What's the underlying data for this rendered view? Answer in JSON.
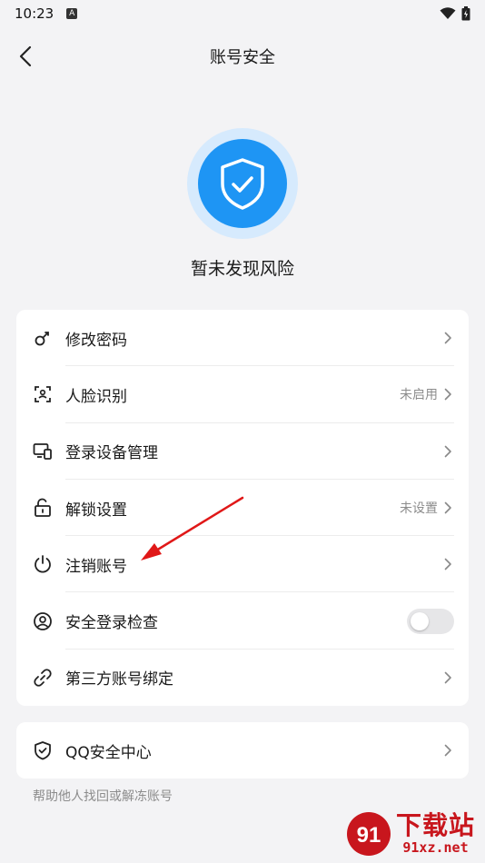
{
  "status_bar": {
    "time": "10:23",
    "notif_icon": "A"
  },
  "header": {
    "title": "账号安全"
  },
  "hero": {
    "icon": "shield-check-icon",
    "status": "暂未发现风险",
    "accent": "#1e95f4"
  },
  "items": [
    {
      "label": "修改密码",
      "value": "",
      "icon": "key-icon"
    },
    {
      "label": "人脸识别",
      "value": "未启用",
      "icon": "face-scan-icon"
    },
    {
      "label": "登录设备管理",
      "value": "",
      "icon": "devices-icon"
    },
    {
      "label": "解锁设置",
      "value": "未设置",
      "icon": "unlock-icon"
    },
    {
      "label": "注销账号",
      "value": "",
      "icon": "power-icon"
    },
    {
      "label": "安全登录检查",
      "value": "",
      "icon": "user-circle-icon",
      "toggle": false
    },
    {
      "label": "第三方账号绑定",
      "value": "",
      "icon": "link-icon"
    }
  ],
  "qq_center": {
    "label": "QQ安全中心",
    "icon": "shield-icon"
  },
  "footer_note": "帮助他人找回或解冻账号",
  "watermark": {
    "text": "下载站",
    "url": "91xz.net",
    "logo": "91"
  }
}
